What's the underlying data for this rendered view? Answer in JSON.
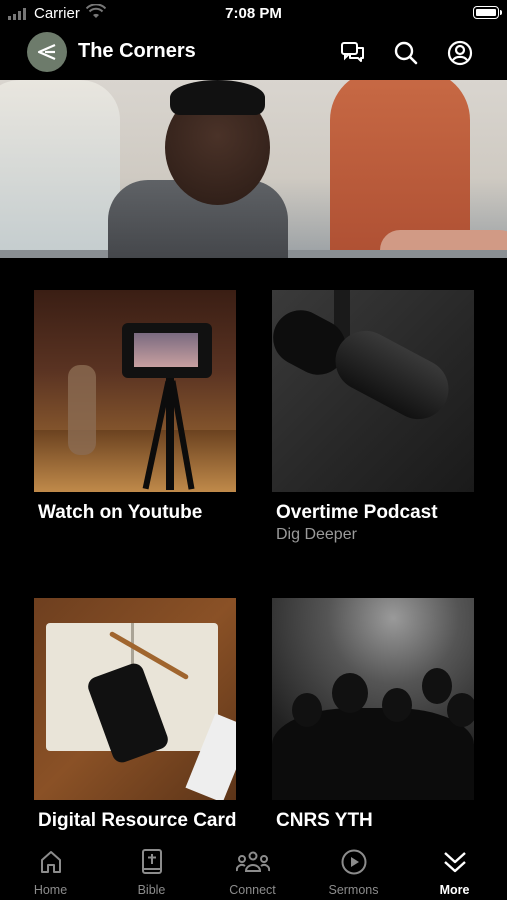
{
  "status": {
    "carrier": "Carrier",
    "time": "7:08 PM"
  },
  "header": {
    "title": "The Corners"
  },
  "cards": [
    {
      "title": "Watch on Youtube",
      "subtitle": ""
    },
    {
      "title": "Overtime Podcast",
      "subtitle": "Dig Deeper"
    },
    {
      "title": "Digital Resource Card",
      "subtitle": ""
    },
    {
      "title": "CNRS YTH",
      "subtitle": ""
    }
  ],
  "tabs": [
    {
      "label": "Home",
      "icon": "home-icon"
    },
    {
      "label": "Bible",
      "icon": "bible-icon"
    },
    {
      "label": "Connect",
      "icon": "connect-icon"
    },
    {
      "label": "Sermons",
      "icon": "play-icon"
    },
    {
      "label": "More",
      "icon": "chevrons-down-icon"
    }
  ],
  "active_tab": "More",
  "colors": {
    "background": "#000000",
    "text": "#ffffff",
    "muted": "#9a9a9a",
    "logo_bg": "#6d7b6b"
  }
}
